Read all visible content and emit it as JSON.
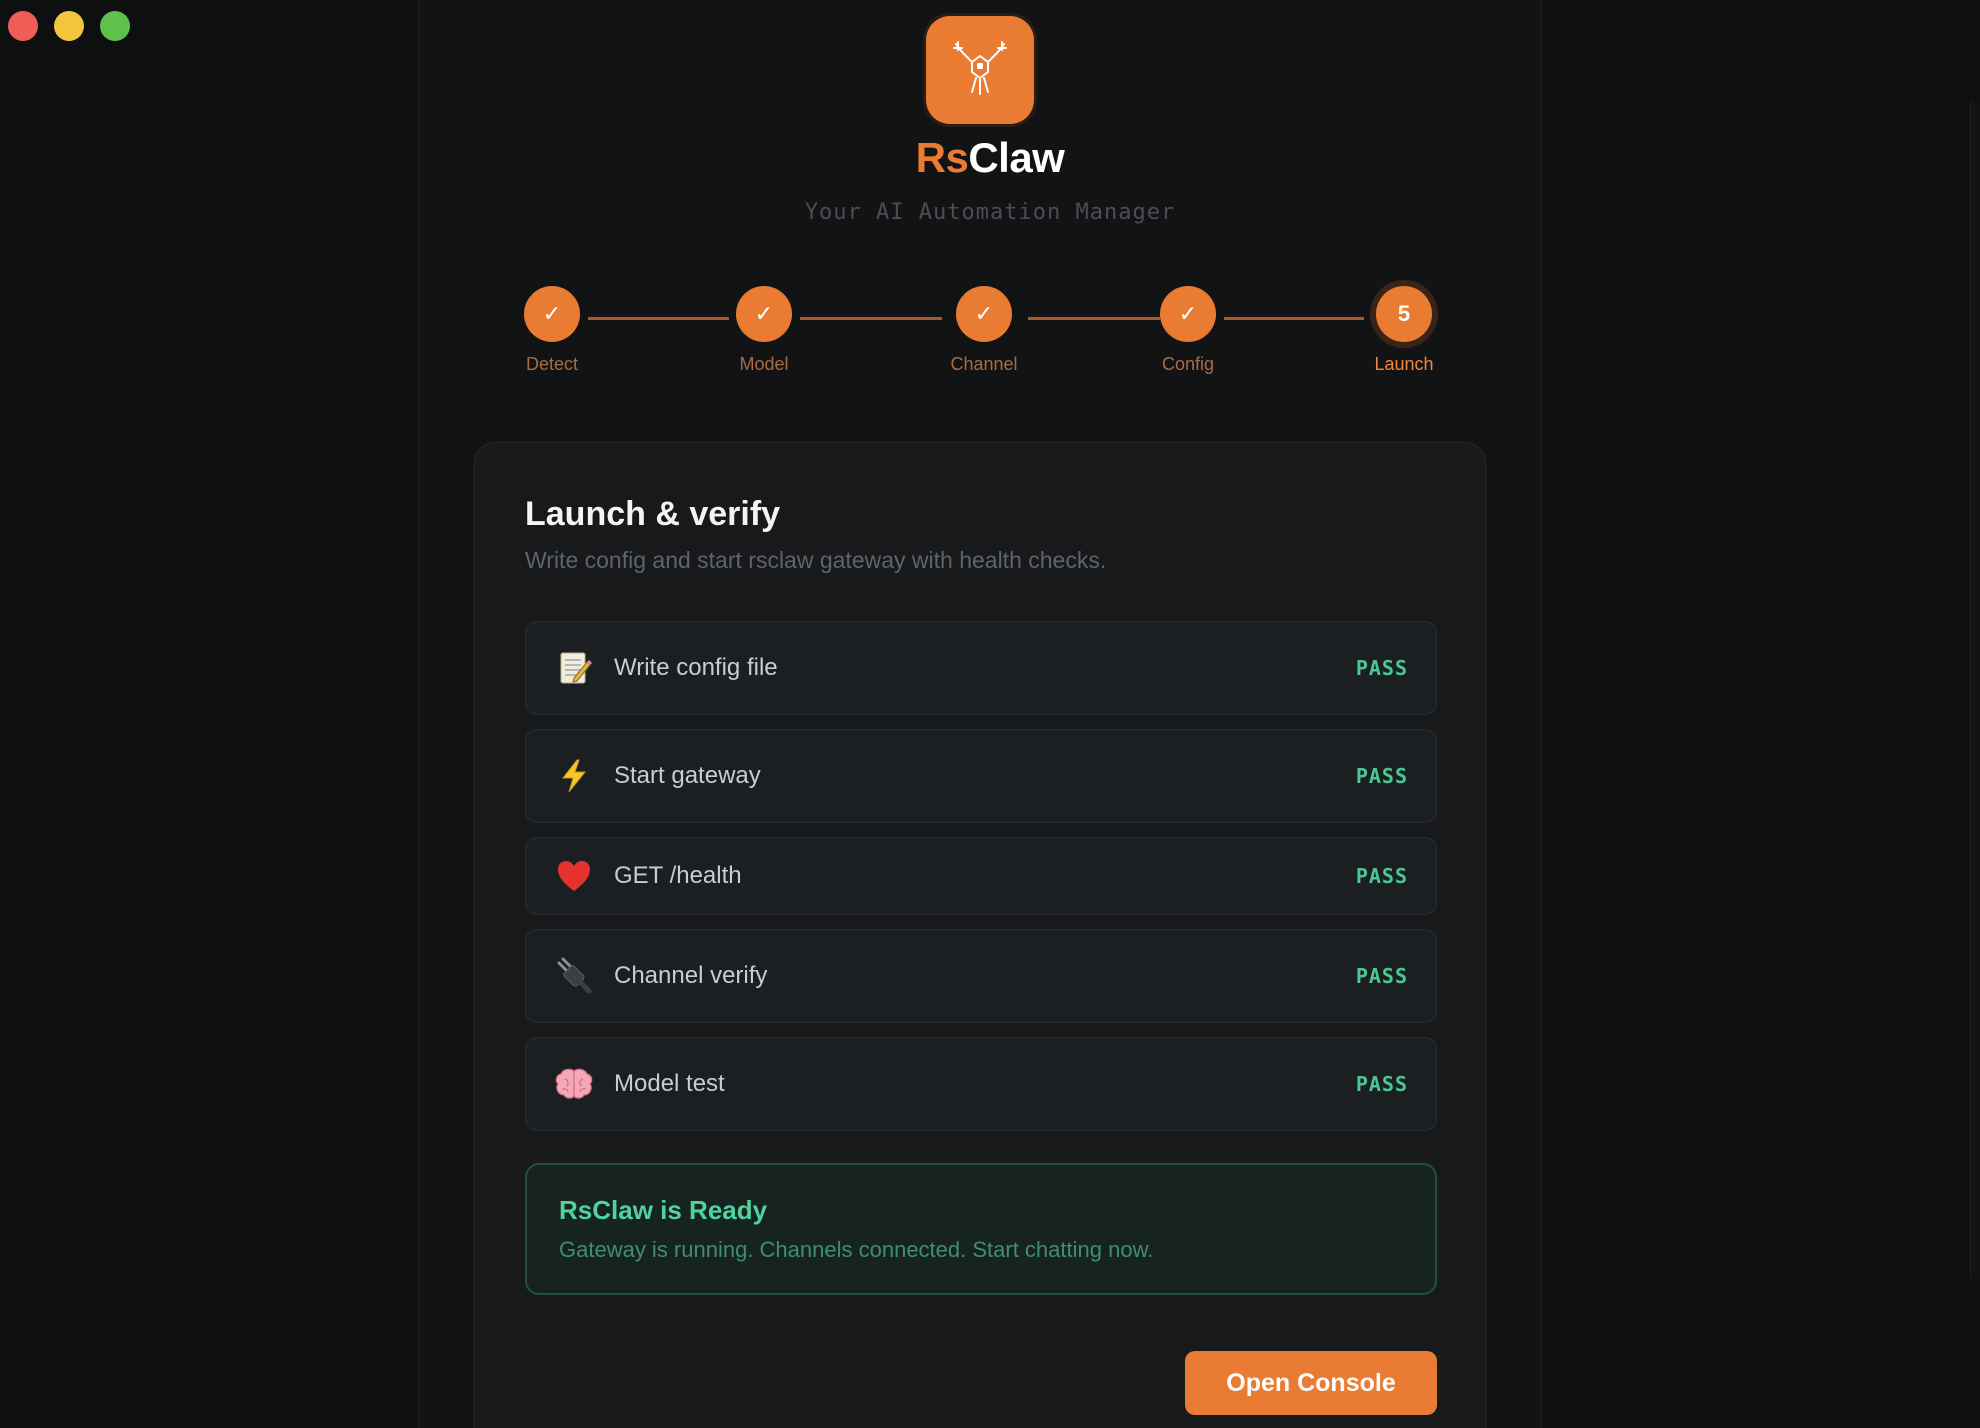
{
  "app": {
    "brand_prefix": "Rs",
    "brand_suffix": "Claw",
    "tagline": "Your AI Automation Manager"
  },
  "stepper": {
    "steps": [
      {
        "label": "Detect",
        "marker": "✓",
        "state": "done"
      },
      {
        "label": "Model",
        "marker": "✓",
        "state": "done"
      },
      {
        "label": "Channel",
        "marker": "✓",
        "state": "done"
      },
      {
        "label": "Config",
        "marker": "✓",
        "state": "done"
      },
      {
        "label": "Launch",
        "marker": "5",
        "state": "active"
      }
    ]
  },
  "card": {
    "title": "Launch & verify",
    "description": "Write config and start rsclaw gateway with health checks."
  },
  "checks": [
    {
      "icon": "memo-icon",
      "label": "Write config file",
      "status": "PASS"
    },
    {
      "icon": "lightning-icon",
      "label": "Start gateway",
      "status": "PASS"
    },
    {
      "icon": "heart-icon",
      "label": "GET /health",
      "status": "PASS"
    },
    {
      "icon": "plug-icon",
      "label": "Channel verify",
      "status": "PASS"
    },
    {
      "icon": "brain-icon",
      "label": "Model test",
      "status": "PASS"
    }
  ],
  "ready": {
    "title": "RsClaw is Ready",
    "description": "Gateway is running. Channels connected. Start chatting now."
  },
  "actions": {
    "open_console": "Open Console"
  },
  "colors": {
    "accent": "#ea7b33",
    "pass": "#49c891",
    "ready_border": "#23503f"
  }
}
